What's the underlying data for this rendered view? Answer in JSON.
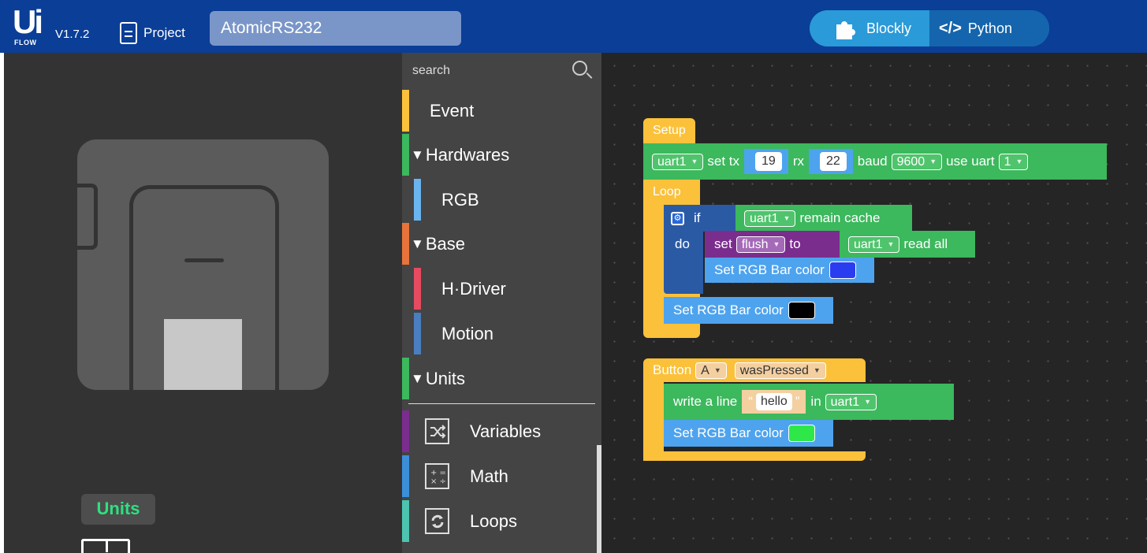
{
  "header": {
    "logo_big": "Ui",
    "logo_small": "FLOW",
    "version": "V1.7.2",
    "project_label": "Project",
    "project_name": "AtomicRS232",
    "modes": [
      {
        "label": "Blockly",
        "icon": "puzzle-icon",
        "active": true
      },
      {
        "label": "Python",
        "icon": "code-icon",
        "icon_text": "</>",
        "active": false
      }
    ]
  },
  "device_panel": {
    "units_tag": "Units"
  },
  "toolbox": {
    "search_placeholder": "search",
    "categories": [
      {
        "label": "Event",
        "color": "#fbc13a",
        "expandable": false
      },
      {
        "label": "Hardwares",
        "color": "#3cb85d",
        "expandable": true,
        "arrow": "▼"
      },
      {
        "label": "RGB",
        "color": "#6ab4f0",
        "sub": true
      },
      {
        "label": "Base",
        "color": "#e8743b",
        "expandable": true,
        "arrow": "▼"
      },
      {
        "label": "H·Driver",
        "color": "#e84a5f",
        "sub": true
      },
      {
        "label": "Motion",
        "color": "#4a7ec0",
        "sub": true
      },
      {
        "label": "Units",
        "color": "#3cb85d",
        "expandable": true,
        "arrow": "▼"
      },
      {
        "label": "Variables",
        "color": "#7b2d8e",
        "icon": "variables-icon"
      },
      {
        "label": "Math",
        "color": "#3b8fd8",
        "icon": "math-icon"
      },
      {
        "label": "Loops",
        "color": "#4cc4b0",
        "icon": "loops-icon"
      }
    ]
  },
  "workspace": {
    "setup": {
      "hat": "Setup",
      "uart_var": "uart1",
      "set_tx": "set tx",
      "tx_value": "19",
      "rx": "rx",
      "rx_value": "22",
      "baud": "baud",
      "baud_value": "9600",
      "use_uart": "use uart",
      "uart_num": "1"
    },
    "loop": {
      "hat": "Loop",
      "if": "if",
      "do": "do",
      "cond_var": "uart1",
      "cond_text": "remain cache",
      "set": "set",
      "set_var": "flush",
      "to": "to",
      "read_var": "uart1",
      "read_text": "read all",
      "rgb_label_1": "Set RGB Bar color",
      "rgb_color_1": "#2a3cf0",
      "rgb_label_2": "Set RGB Bar color",
      "rgb_color_2": "#000000"
    },
    "button": {
      "hat": "Button",
      "button_var": "A",
      "event": "wasPressed",
      "write": "write a line",
      "open_quote": "“",
      "string": "hello",
      "close_quote": "”",
      "in": "in",
      "in_var": "uart1",
      "rgb_label": "Set RGB Bar color",
      "rgb_color": "#2ee84a"
    }
  }
}
